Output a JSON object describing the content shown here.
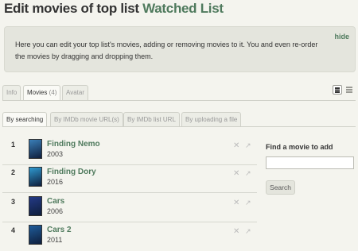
{
  "header": {
    "title_prefix": "Edit movies of top list ",
    "list_name": "Watched List"
  },
  "info": {
    "text": "Here you can edit your top list's movies, adding or removing movies to it. You and even re-order the movies by dragging and dropping them.",
    "hide_label": "hide"
  },
  "tabs": [
    {
      "label": "Info"
    },
    {
      "label": "Movies",
      "count": "(4)"
    },
    {
      "label": "Avatar"
    }
  ],
  "subtabs": [
    {
      "label": "By searching"
    },
    {
      "label": "By IMDb movie URL(s)"
    },
    {
      "label": "By IMDb list URL"
    },
    {
      "label": "By uploading a file"
    }
  ],
  "movies": [
    {
      "rank": "1",
      "title": "Finding Nemo",
      "year": "2003",
      "poster_color": "#3a7fb8"
    },
    {
      "rank": "2",
      "title": "Finding Dory",
      "year": "2016",
      "poster_color": "#2f9ad0"
    },
    {
      "rank": "3",
      "title": "Cars",
      "year": "2006",
      "poster_color": "#243a86"
    },
    {
      "rank": "4",
      "title": "Cars 2",
      "year": "2011",
      "poster_color": "#1f5c9a"
    }
  ],
  "finder": {
    "title": "Find a movie to add",
    "input_value": "",
    "button_label": "Search"
  },
  "icons": {
    "remove": "close-icon",
    "move": "move-icon",
    "grid_view": "grid-view-icon",
    "list_view": "list-view-icon"
  },
  "colors": {
    "accent": "#4f7a5d",
    "info_bg": "#e4e5dd",
    "page_bg": "#f4f4ee"
  }
}
